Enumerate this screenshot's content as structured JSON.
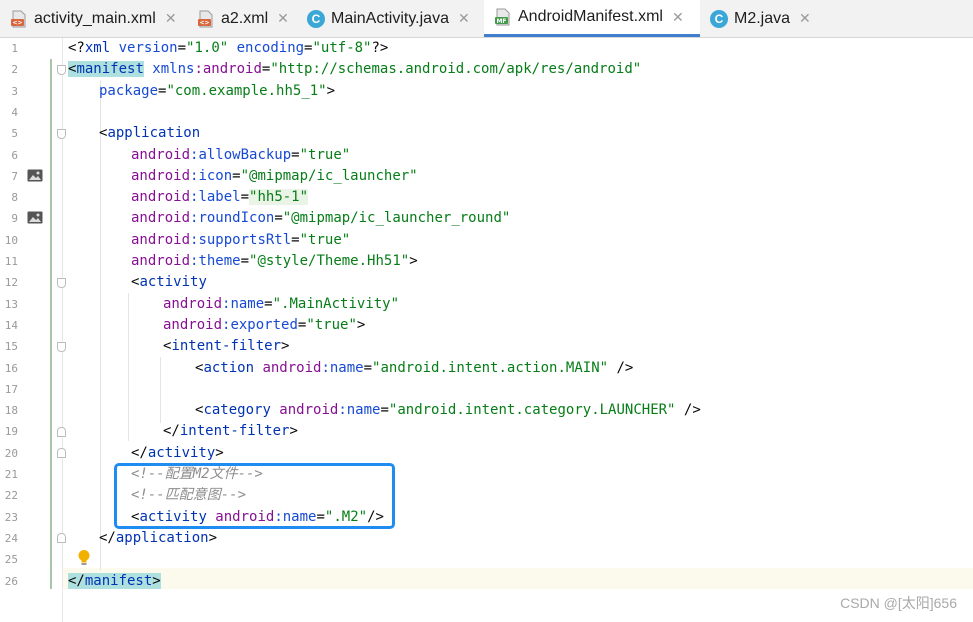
{
  "tabs": [
    {
      "label": "activity_main.xml",
      "icon": "xml-file-icon",
      "active": false
    },
    {
      "label": "a2.xml",
      "icon": "xml-file-icon",
      "active": false
    },
    {
      "label": "MainActivity.java",
      "icon": "java-class-icon",
      "active": false
    },
    {
      "label": "AndroidManifest.xml",
      "icon": "manifest-file-icon",
      "active": true
    },
    {
      "label": "M2.java",
      "icon": "java-class-icon",
      "active": false
    }
  ],
  "close_glyph": "✕",
  "line_numbers": [
    "1",
    "2",
    "3",
    "4",
    "5",
    "6",
    "7",
    "8",
    "9",
    "10",
    "11",
    "12",
    "13",
    "14",
    "15",
    "16",
    "17",
    "18",
    "19",
    "20",
    "21",
    "22",
    "23",
    "24",
    "25",
    "26"
  ],
  "code": {
    "l1": {
      "a": "<?",
      "b": "xml",
      "c": " version",
      "d": "=",
      "e": "\"1.0\"",
      "f": " encoding",
      "g": "=",
      "h": "\"utf-8\"",
      "i": "?>"
    },
    "l2": {
      "a": "<",
      "b": "manifest",
      "c": " xmlns",
      "d": ":android",
      "e": "=",
      "f": "\"http://schemas.android.com/apk/res/android\""
    },
    "l3": {
      "a": "package",
      "b": "=",
      "c": "\"com.example.hh5_1\"",
      "d": ">"
    },
    "l5": {
      "a": "<",
      "b": "application"
    },
    "l6": {
      "ns": "android",
      "attr": ":allowBackup",
      "eq": "=",
      "val": "\"true\""
    },
    "l7": {
      "ns": "android",
      "attr": ":icon",
      "eq": "=",
      "val": "\"@mipmap/ic_launcher\""
    },
    "l8": {
      "ns": "android",
      "attr": ":label",
      "eq": "=",
      "val": "\"hh5-1\""
    },
    "l9": {
      "ns": "android",
      "attr": ":roundIcon",
      "eq": "=",
      "val": "\"@mipmap/ic_launcher_round\""
    },
    "l10": {
      "ns": "android",
      "attr": ":supportsRtl",
      "eq": "=",
      "val": "\"true\""
    },
    "l11": {
      "ns": "android",
      "attr": ":theme",
      "eq": "=",
      "val": "\"@style/Theme.Hh51\"",
      "end": ">"
    },
    "l12": {
      "a": "<",
      "b": "activity"
    },
    "l13": {
      "ns": "android",
      "attr": ":name",
      "eq": "=",
      "val": "\".MainActivity\""
    },
    "l14": {
      "ns": "android",
      "attr": ":exported",
      "eq": "=",
      "val": "\"true\"",
      "end": ">"
    },
    "l15": {
      "a": "<",
      "b": "intent-filter",
      "c": ">"
    },
    "l16": {
      "a": "<",
      "b": "action",
      "ns": " android",
      "attr": ":name",
      "eq": "=",
      "val": "\"android.intent.action.MAIN\"",
      "end": " />"
    },
    "l18": {
      "a": "<",
      "b": "category",
      "ns": " android",
      "attr": ":name",
      "eq": "=",
      "val": "\"android.intent.category.LAUNCHER\"",
      "end": " />"
    },
    "l19": {
      "a": "</",
      "b": "intent-filter",
      "c": ">"
    },
    "l20": {
      "a": "</",
      "b": "activity",
      "c": ">"
    },
    "l21": {
      "comment": "<!--配置M2文件-->"
    },
    "l22": {
      "comment": "<!--匹配意图-->"
    },
    "l23": {
      "a": "<",
      "b": "activity",
      "ns": " android",
      "attr": ":name",
      "eq": "=",
      "val": "\".M2\"",
      "end": "/>"
    },
    "l24": {
      "a": "</",
      "b": "application",
      "c": ">"
    },
    "l26": {
      "a": "</",
      "b": "manifest",
      "c": ">"
    }
  },
  "watermark": "CSDN @[太阳]656",
  "colors": {
    "tag": "#0033b3",
    "namespace": "#871094",
    "value": "#067d17",
    "comment": "#8c8c8c",
    "callout": "#1e8cf0",
    "active_tab_underline": "#3f7fcd"
  }
}
